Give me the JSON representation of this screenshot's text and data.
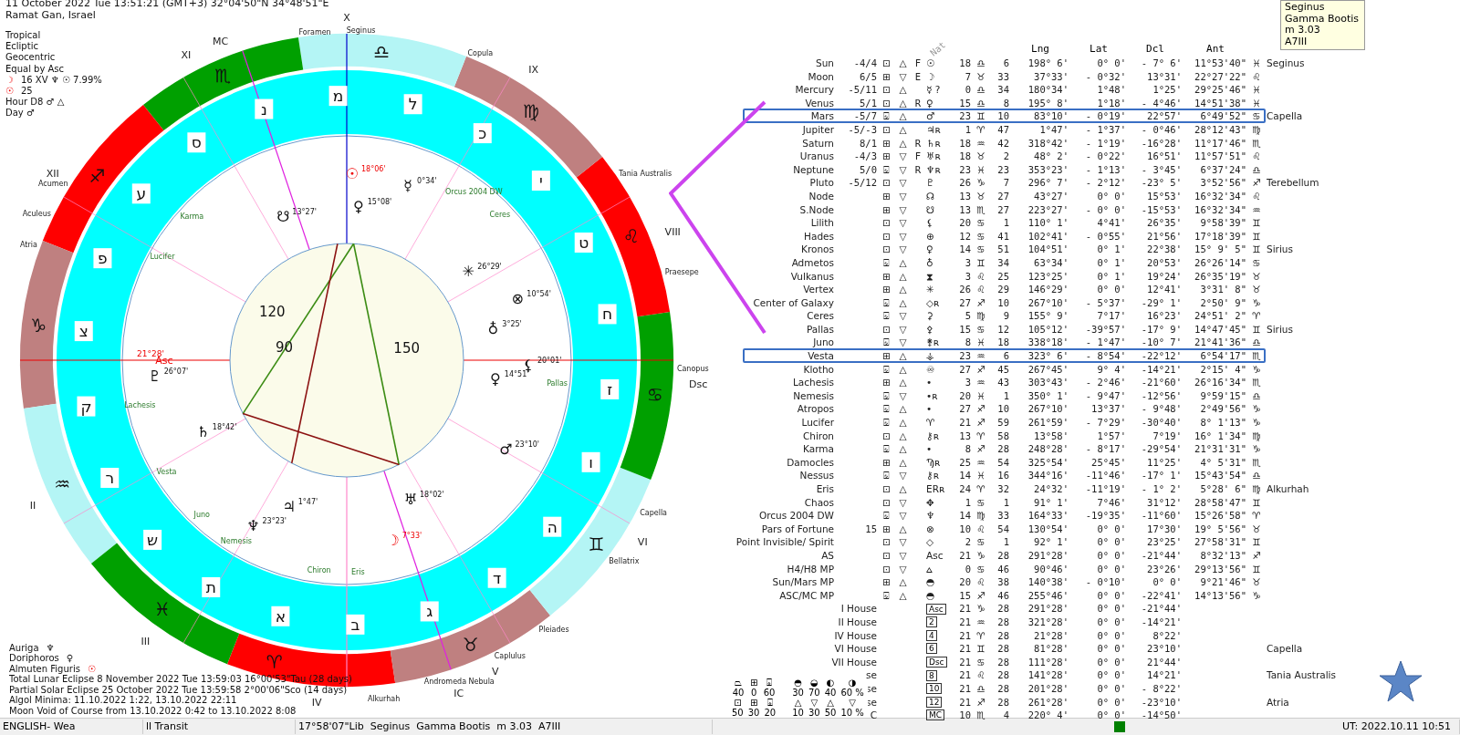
{
  "header": {
    "date_line": "11 October 2022  Tue  13:51:21 (GMT+3) 32°04'50\"N  34°48'51\"E",
    "location": "Ramat Gan, Israel",
    "settings": [
      "Tropical",
      "Ecliptic",
      "Geocentric",
      "Equal by Asc"
    ],
    "lines": [
      {
        "icon": "☽",
        "highlight": true,
        "text": "16 XV ♆ ☉ 7.99%"
      },
      {
        "icon": "☉",
        "highlight": true,
        "text": "25"
      },
      {
        "text": "Hour D8 ♂ △"
      },
      {
        "text": "Day ♂"
      }
    ]
  },
  "footer": {
    "rulers": [
      {
        "label": "Auriga",
        "glyph": "♆",
        "highlight": false
      },
      {
        "label": "Doriphoros",
        "glyph": "♀",
        "highlight": false
      },
      {
        "label": "Almuten Figuris",
        "glyph": "☉",
        "highlight": true
      }
    ],
    "notes": [
      "Total Lunar Eclipse 8 November 2022 Tue 13:59:03 16°00'53\"Tau (28 days)",
      "Partial Solar Eclipse 25 October 2022 Tue 13:59:58  2°00'06\"Sco (14 days)",
      "Algol Minima: 11.10.2022  1:22,  13.10.2022 22:11",
      "Moon Void of Course from 13.10.2022  0:42 to 13.10.2022  8:08"
    ]
  },
  "wheel": {
    "asc_label": "21°28'",
    "zodiac": [
      {
        "glyph": "♈",
        "color": "#ff0000"
      },
      {
        "glyph": "♉",
        "color": "#bf8080"
      },
      {
        "glyph": "♊",
        "color": "#b4f5f5"
      },
      {
        "glyph": "♋",
        "color": "#00a000"
      },
      {
        "glyph": "♌",
        "color": "#ff0000"
      },
      {
        "glyph": "♍",
        "color": "#bf8080"
      },
      {
        "glyph": "♎",
        "color": "#b4f5f5"
      },
      {
        "glyph": "♏",
        "color": "#00a000"
      },
      {
        "glyph": "♐",
        "color": "#ff0000"
      },
      {
        "glyph": "♑",
        "color": "#bf8080"
      },
      {
        "glyph": "♒",
        "color": "#b4f5f5"
      },
      {
        "glyph": "♓",
        "color": "#00a000"
      }
    ],
    "houses": [
      "Asc",
      "II",
      "III",
      "IV",
      "V",
      "VI",
      "Dsc",
      "VIII",
      "IX",
      "X",
      "XI",
      "XII"
    ],
    "angles": [
      {
        "label": "MC"
      },
      {
        "label": "IC"
      }
    ],
    "hebrew_letters": [
      "א",
      "ב",
      "ג",
      "ד",
      "ה",
      "ו",
      "ז",
      "ח",
      "ט",
      "י",
      "כ",
      "ל",
      "מ",
      "נ",
      "ס",
      "ע",
      "פ",
      "צ",
      "ק",
      "ר",
      "ש",
      "ת"
    ],
    "stars": [
      {
        "name": "Foramen"
      },
      {
        "name": "Seginus"
      },
      {
        "name": "Copula"
      },
      {
        "name": "Tania Australis"
      },
      {
        "name": "Praesepe"
      },
      {
        "name": "Canopus"
      },
      {
        "name": "Capella"
      },
      {
        "name": "Bellatrix"
      },
      {
        "name": "Pleiades"
      },
      {
        "name": "Caplulus"
      },
      {
        "name": "Andromeda Nebula"
      },
      {
        "name": "Alkurhah"
      },
      {
        "name": "Atria"
      },
      {
        "name": "Aculeus"
      },
      {
        "name": "Acumen"
      }
    ],
    "points": [
      {
        "glyph": "☉",
        "degree": "18°06'",
        "kind": "luminary"
      },
      {
        "glyph": "♀",
        "degree": "15°08'",
        "kind": "planet"
      },
      {
        "glyph": "☿",
        "degree": "0°34'",
        "kind": "planet"
      },
      {
        "glyph": "✳",
        "degree": "26°29'",
        "kind": "planet"
      },
      {
        "glyph": "⊗",
        "degree": "10°54'",
        "kind": "planet"
      },
      {
        "glyph": "♁",
        "degree": "3°25'",
        "kind": "planet"
      },
      {
        "glyph": "⚸",
        "degree": "20°01'",
        "kind": "planet"
      },
      {
        "glyph": "♀",
        "degree": "14°51'",
        "kind": "planet"
      },
      {
        "glyph": "♂",
        "degree": "23°10'",
        "kind": "planet"
      },
      {
        "glyph": "♅",
        "degree": "18°02'",
        "kind": "planet"
      },
      {
        "glyph": "☽",
        "degree": "7°33'",
        "kind": "luminary"
      },
      {
        "glyph": "♃",
        "degree": "1°47'",
        "kind": "planet"
      },
      {
        "glyph": "♆",
        "degree": "23°23'",
        "kind": "planet"
      },
      {
        "glyph": "♄",
        "degree": "18°42'",
        "kind": "planet"
      },
      {
        "glyph": "♇",
        "degree": "26°07'",
        "kind": "planet"
      },
      {
        "glyph": "☋",
        "degree": "13°27'",
        "kind": "planet"
      }
    ],
    "minor": [
      {
        "name": "Lucifer"
      },
      {
        "name": "Karma"
      },
      {
        "name": "Lachesis"
      },
      {
        "name": "Vesta"
      },
      {
        "name": "Juno"
      },
      {
        "name": "Nemesis"
      },
      {
        "name": "Chiron"
      },
      {
        "name": "Eris"
      },
      {
        "name": "Orcus 2004 DW"
      },
      {
        "name": "Ceres"
      },
      {
        "name": "Pallas"
      }
    ],
    "aspects": [
      {
        "kind": "trine",
        "label": "120"
      },
      {
        "kind": "trine",
        "label": "150"
      },
      {
        "kind": "square",
        "label": "90"
      },
      {
        "kind": "square"
      }
    ]
  },
  "table": {
    "header": {
      "nat": "Nat",
      "lng": "Lng",
      "lat": "Lat",
      "dcl": "Dcl",
      "ant": "Ant"
    },
    "rows": [
      {
        "kind": "point",
        "name": "Sun",
        "score": "-4/4",
        "quad": "⊡",
        "elem": "△",
        "flag": "F",
        "glyph": "☉",
        "deg": "18",
        "sign": "♎",
        "min": "6",
        "lng": "198° 6'",
        "lat": "0° 0'",
        "dcl": "- 7° 6'",
        "ant": "11°53'40\"",
        "ant_sign": "♓",
        "star": "Seginus",
        "selected": false
      },
      {
        "kind": "point",
        "name": "Moon",
        "score": "6/5",
        "quad": "⊞",
        "elem": "▽",
        "flag": "E",
        "glyph": "☽",
        "deg": "7",
        "sign": "♉",
        "min": "33",
        "lng": "37°33'",
        "lat": "- 0°32'",
        "dcl": "13°31'",
        "ant": "22°27'22\"",
        "ant_sign": "♌",
        "selected": false
      },
      {
        "kind": "point",
        "name": "Mercury",
        "score": "-5/11",
        "quad": "⊡",
        "elem": "△",
        "glyph": "☿ ?",
        "deg": "0",
        "sign": "♎",
        "min": "34",
        "lng": "180°34'",
        "lat": "1°48'",
        "dcl": "1°25'",
        "ant": "29°25'46\"",
        "ant_sign": "♓",
        "selected": false
      },
      {
        "kind": "point",
        "name": "Venus",
        "score": "5/1",
        "quad": "⊡",
        "elem": "△",
        "flag": "R",
        "glyph": "♀",
        "deg": "15",
        "sign": "♎",
        "min": "8",
        "lng": "195° 8'",
        "lat": "1°18'",
        "dcl": "- 4°46'",
        "ant": "14°51'38\"",
        "ant_sign": "♓",
        "selected": false
      },
      {
        "kind": "point",
        "name": "Mars",
        "score": "-5/7",
        "quad": "⌺",
        "elem": "△",
        "glyph": "♂",
        "deg": "23",
        "sign": "♊",
        "min": "10",
        "lng": "83°10'",
        "lat": "- 0°19'",
        "dcl": "22°57'",
        "ant": "6°49'52\"",
        "ant_sign": "♋",
        "star": "Capella",
        "selected": true
      },
      {
        "kind": "point",
        "name": "Jupiter",
        "score": "-5/-3",
        "quad": "⊡",
        "elem": "△",
        "glyph": "♃ʀ",
        "deg": "1",
        "sign": "♈",
        "min": "47",
        "lng": "1°47'",
        "lat": "- 1°37'",
        "dcl": "- 0°46'",
        "ant": "28°12'43\"",
        "ant_sign": "♍",
        "selected": false
      },
      {
        "kind": "point",
        "name": "Saturn",
        "score": "8/1",
        "quad": "⊞",
        "elem": "△",
        "flag": "R",
        "glyph": "♄ʀ",
        "deg": "18",
        "sign": "♒",
        "min": "42",
        "lng": "318°42'",
        "lat": "- 1°19'",
        "dcl": "-16°28'",
        "ant": "11°17'46\"",
        "ant_sign": "♏",
        "selected": false
      },
      {
        "kind": "point",
        "name": "Uranus",
        "score": "-4/3",
        "quad": "⊞",
        "elem": "▽",
        "flag": "F",
        "glyph": "♅ʀ",
        "deg": "18",
        "sign": "♉",
        "min": "2",
        "lng": "48° 2'",
        "lat": "- 0°22'",
        "dcl": "16°51'",
        "ant": "11°57'51\"",
        "ant_sign": "♌",
        "selected": false
      },
      {
        "kind": "point",
        "name": "Neptune",
        "score": "5/0",
        "quad": "⌺",
        "elem": "▽",
        "flag": "R",
        "glyph": "♆ʀ",
        "deg": "23",
        "sign": "♓",
        "min": "23",
        "lng": "353°23'",
        "lat": "- 1°13'",
        "dcl": "- 3°45'",
        "ant": "6°37'24\"",
        "ant_sign": "♎",
        "selected": false
      },
      {
        "kind": "point",
        "name": "Pluto",
        "score": "-5/12",
        "quad": "⊡",
        "elem": "▽",
        "glyph": "♇",
        "deg": "26",
        "sign": "♑",
        "min": "7",
        "lng": "296° 7'",
        "lat": "- 2°12'",
        "dcl": "-23° 5'",
        "ant": "3°52'56\"",
        "ant_sign": "♐",
        "star": "Terebellum",
        "selected": false
      },
      {
        "kind": "point",
        "name": "Node",
        "quad": "⊞",
        "elem": "▽",
        "glyph": "☊",
        "deg": "13",
        "sign": "♉",
        "min": "27",
        "lng": "43°27'",
        "lat": "0° 0'",
        "dcl": "15°53'",
        "ant": "16°32'34\"",
        "ant_sign": "♌",
        "selected": false
      },
      {
        "kind": "point",
        "name": "S.Node",
        "quad": "⊞",
        "elem": "▽",
        "glyph": "☋",
        "deg": "13",
        "sign": "♏",
        "min": "27",
        "lng": "223°27'",
        "lat": "- 0° 0'",
        "dcl": "-15°53'",
        "ant": "16°32'34\"",
        "ant_sign": "♒",
        "selected": false
      },
      {
        "kind": "point",
        "name": "Lilith",
        "quad": "⊡",
        "elem": "▽",
        "glyph": "⚸",
        "deg": "20",
        "sign": "♋",
        "min": "1",
        "lng": "110° 1'",
        "lat": "4°41'",
        "dcl": "26°35'",
        "ant": "9°58'39\"",
        "ant_sign": "♊",
        "selected": false
      },
      {
        "kind": "point",
        "name": "Hades",
        "quad": "⊡",
        "elem": "▽",
        "glyph": "⊕",
        "deg": "12",
        "sign": "♋",
        "min": "41",
        "lng": "102°41'",
        "lat": "- 0°55'",
        "dcl": "21°56'",
        "ant": "17°18'39\"",
        "ant_sign": "♊",
        "selected": false
      },
      {
        "kind": "point",
        "name": "Kronos",
        "quad": "⊡",
        "elem": "▽",
        "glyph": "♀",
        "deg": "14",
        "sign": "♋",
        "min": "51",
        "lng": "104°51'",
        "lat": "0° 1'",
        "dcl": "22°38'",
        "ant": "15° 9' 5\"",
        "ant_sign": "♊",
        "star": "Sirius",
        "selected": false
      },
      {
        "kind": "point",
        "name": "Admetos",
        "quad": "⌺",
        "elem": "△",
        "glyph": "♁",
        "deg": "3",
        "sign": "♊",
        "min": "34",
        "lng": "63°34'",
        "lat": "0° 1'",
        "dcl": "20°53'",
        "ant": "26°26'14\"",
        "ant_sign": "♋",
        "selected": false
      },
      {
        "kind": "point",
        "name": "Vulkanus",
        "quad": "⊞",
        "elem": "△",
        "glyph": "⧗",
        "deg": "3",
        "sign": "♌",
        "min": "25",
        "lng": "123°25'",
        "lat": "0° 1'",
        "dcl": "19°24'",
        "ant": "26°35'19\"",
        "ant_sign": "♉",
        "selected": false
      },
      {
        "kind": "point",
        "name": "Vertex",
        "quad": "⊞",
        "elem": "△",
        "glyph": "✳",
        "deg": "26",
        "sign": "♌",
        "min": "29",
        "lng": "146°29'",
        "lat": "0° 0'",
        "dcl": "12°41'",
        "ant": "3°31' 8\"",
        "ant_sign": "♉",
        "selected": false
      },
      {
        "kind": "point",
        "name": "Center of Galaxy",
        "quad": "⌺",
        "elem": "△",
        "glyph": "◇ʀ",
        "deg": "27",
        "sign": "♐",
        "min": "10",
        "lng": "267°10'",
        "lat": "- 5°37'",
        "dcl": "-29° 1'",
        "ant": "2°50' 9\"",
        "ant_sign": "♑",
        "selected": false
      },
      {
        "kind": "point",
        "name": "Ceres",
        "quad": "⌺",
        "elem": "▽",
        "glyph": "⚳",
        "deg": "5",
        "sign": "♍",
        "min": "9",
        "lng": "155° 9'",
        "lat": "7°17'",
        "dcl": "16°23'",
        "ant": "24°51' 2\"",
        "ant_sign": "♈",
        "selected": false
      },
      {
        "kind": "point",
        "name": "Pallas",
        "quad": "⊡",
        "elem": "▽",
        "glyph": "⚴",
        "deg": "15",
        "sign": "♋",
        "min": "12",
        "lng": "105°12'",
        "lat": "-39°57'",
        "dcl": "-17° 9'",
        "ant": "14°47'45\"",
        "ant_sign": "♊",
        "star": "Sirius",
        "selected": false
      },
      {
        "kind": "point",
        "name": "Juno",
        "quad": "⌺",
        "elem": "▽",
        "glyph": "⚵ʀ",
        "deg": "8",
        "sign": "♓",
        "min": "18",
        "lng": "338°18'",
        "lat": "- 1°47'",
        "dcl": "-10° 7'",
        "ant": "21°41'36\"",
        "ant_sign": "♎",
        "selected": false
      },
      {
        "kind": "point",
        "name": "Vesta",
        "quad": "⊞",
        "elem": "△",
        "glyph": "⚶",
        "deg": "23",
        "sign": "♒",
        "min": "6",
        "lng": "323° 6'",
        "lat": "- 8°54'",
        "dcl": "-22°12'",
        "ant": "6°54'17\"",
        "ant_sign": "♏",
        "selected": true
      },
      {
        "kind": "point",
        "name": "Klotho",
        "quad": "⌺",
        "elem": "△",
        "glyph": "♾",
        "deg": "27",
        "sign": "♐",
        "min": "45",
        "lng": "267°45'",
        "lat": "9° 4'",
        "dcl": "-14°21'",
        "ant": "2°15' 4\"",
        "ant_sign": "♑",
        "selected": false
      },
      {
        "kind": "point",
        "name": "Lachesis",
        "quad": "⊞",
        "elem": "△",
        "glyph": "•",
        "deg": "3",
        "sign": "♒",
        "min": "43",
        "lng": "303°43'",
        "lat": "- 2°46'",
        "dcl": "-21°60'",
        "ant": "26°16'34\"",
        "ant_sign": "♏",
        "selected": false
      },
      {
        "kind": "point",
        "name": "Nemesis",
        "quad": "⌺",
        "elem": "▽",
        "glyph": "•ʀ",
        "deg": "20",
        "sign": "♓",
        "min": "1",
        "lng": "350° 1'",
        "lat": "- 9°47'",
        "dcl": "-12°56'",
        "ant": "9°59'15\"",
        "ant_sign": "♎",
        "selected": false
      },
      {
        "kind": "point",
        "name": "Atropos",
        "quad": "⌺",
        "elem": "△",
        "glyph": "•",
        "deg": "27",
        "sign": "♐",
        "min": "10",
        "lng": "267°10'",
        "lat": "13°37'",
        "dcl": "- 9°48'",
        "ant": "2°49'56\"",
        "ant_sign": "♑",
        "selected": false
      },
      {
        "kind": "point",
        "name": "Lucifer",
        "quad": "⌺",
        "elem": "△",
        "glyph": "♈",
        "deg": "21",
        "sign": "♐",
        "min": "59",
        "lng": "261°59'",
        "lat": "- 7°29'",
        "dcl": "-30°40'",
        "ant": "8° 1'13\"",
        "ant_sign": "♑",
        "selected": false
      },
      {
        "kind": "point",
        "name": "Chiron",
        "quad": "⊡",
        "elem": "△",
        "glyph": "⚷ʀ",
        "deg": "13",
        "sign": "♈",
        "min": "58",
        "lng": "13°58'",
        "lat": "1°57'",
        "dcl": "7°19'",
        "ant": "16° 1'34\"",
        "ant_sign": "♍",
        "selected": false
      },
      {
        "kind": "point",
        "name": "Karma",
        "quad": "⌺",
        "elem": "△",
        "glyph": "•",
        "deg": "8",
        "sign": "♐",
        "min": "28",
        "lng": "248°28'",
        "lat": "- 8°17'",
        "dcl": "-29°54'",
        "ant": "21°31'31\"",
        "ant_sign": "♑",
        "selected": false
      },
      {
        "kind": "point",
        "name": "Damocles",
        "quad": "⊞",
        "elem": "△",
        "glyph": "Ϡʀ",
        "deg": "25",
        "sign": "♒",
        "min": "54",
        "lng": "325°54'",
        "lat": "25°45'",
        "dcl": "11°25'",
        "ant": "4° 5'31\"",
        "ant_sign": "♏",
        "selected": false
      },
      {
        "kind": "point",
        "name": "Nessus",
        "quad": "⌺",
        "elem": "▽",
        "glyph": "⚷ʀ",
        "deg": "14",
        "sign": "♓",
        "min": "16",
        "lng": "344°16'",
        "lat": "-11°46'",
        "dcl": "-17° 1'",
        "ant": "15°43'54\"",
        "ant_sign": "♎",
        "selected": false
      },
      {
        "kind": "point",
        "name": "Eris",
        "quad": "⊡",
        "elem": "△",
        "glyph": "ERʀ",
        "deg": "24",
        "sign": "♈",
        "min": "32",
        "lng": "24°32'",
        "lat": "-11°19'",
        "dcl": "- 1° 2'",
        "ant": "5°28' 6\"",
        "ant_sign": "♍",
        "star": "Alkurhah",
        "selected": false
      },
      {
        "kind": "point",
        "name": "Chaos",
        "quad": "⊡",
        "elem": "▽",
        "glyph": "✥",
        "deg": "1",
        "sign": "♋",
        "min": "1",
        "lng": "91° 1'",
        "lat": "7°46'",
        "dcl": "31°12'",
        "ant": "28°58'47\"",
        "ant_sign": "♊",
        "selected": false
      },
      {
        "kind": "point",
        "name": "Orcus 2004 DW",
        "quad": "⌺",
        "elem": "▽",
        "glyph": "♆",
        "deg": "14",
        "sign": "♍",
        "min": "33",
        "lng": "164°33'",
        "lat": "-19°35'",
        "dcl": "-11°60'",
        "ant": "15°26'58\"",
        "ant_sign": "♈",
        "selected": false
      },
      {
        "kind": "point",
        "name": "Pars of Fortune",
        "score": "15",
        "quad": "⊞",
        "elem": "△",
        "glyph": "⊗",
        "deg": "10",
        "sign": "♌",
        "min": "54",
        "lng": "130°54'",
        "lat": "0° 0'",
        "dcl": "17°30'",
        "ant": "19° 5'56\"",
        "ant_sign": "♉",
        "selected": false
      },
      {
        "kind": "point",
        "name": "Point Invisible/ Spirit",
        "quad": "⊡",
        "elem": "▽",
        "glyph": "◇",
        "deg": "2",
        "sign": "♋",
        "min": "1",
        "lng": "92° 1'",
        "lat": "0° 0'",
        "dcl": "23°25'",
        "ant": "27°58'31\"",
        "ant_sign": "♊",
        "selected": false
      },
      {
        "kind": "point",
        "name": "AS",
        "quad": "⊡",
        "elem": "▽",
        "glyph": "Asc",
        "deg": "21",
        "sign": "♑",
        "min": "28",
        "lng": "291°28'",
        "lat": "0° 0'",
        "dcl": "-21°44'",
        "ant": "8°32'13\"",
        "ant_sign": "♐",
        "selected": false
      },
      {
        "kind": "point",
        "name": "H4/H8 MP",
        "quad": "⊡",
        "elem": "▽",
        "glyph": "⩟",
        "deg": "0",
        "sign": "♋",
        "min": "46",
        "lng": "90°46'",
        "lat": "0° 0'",
        "dcl": "23°26'",
        "ant": "29°13'56\"",
        "ant_sign": "♊",
        "selected": false
      },
      {
        "kind": "point",
        "name": "Sun/Mars MP",
        "quad": "⊞",
        "elem": "△",
        "glyph": "◓",
        "deg": "20",
        "sign": "♌",
        "min": "38",
        "lng": "140°38'",
        "lat": "- 0°10'",
        "dcl": "0° 0'",
        "ant": "9°21'46\"",
        "ant_sign": "♉",
        "selected": false
      },
      {
        "kind": "point",
        "name": "ASC/MC MP",
        "quad": "⌺",
        "elem": "△",
        "glyph": "◓",
        "deg": "15",
        "sign": "♐",
        "min": "46",
        "lng": "255°46'",
        "lat": "0° 0'",
        "dcl": "-22°41'",
        "ant": "14°13'56\"",
        "ant_sign": "♑",
        "selected": false
      },
      {
        "kind": "house",
        "name": "I House",
        "glyph": "Asc",
        "deg": "21",
        "sign": "♑",
        "min": "28",
        "lng": "291°28'",
        "lat": "0° 0'",
        "dcl": "-21°44'"
      },
      {
        "kind": "house",
        "name": "II House",
        "glyph": "2",
        "deg": "21",
        "sign": "♒",
        "min": "28",
        "lng": "321°28'",
        "lat": "0° 0'",
        "dcl": "-14°21'"
      },
      {
        "kind": "house",
        "name": "IV House",
        "glyph": "4",
        "deg": "21",
        "sign": "♈",
        "min": "28",
        "lng": "21°28'",
        "lat": "0° 0'",
        "dcl": "8°22'"
      },
      {
        "kind": "house",
        "name": "VI House",
        "glyph": "6",
        "deg": "21",
        "sign": "♊",
        "min": "28",
        "lng": "81°28'",
        "lat": "0° 0'",
        "dcl": "23°10'",
        "star": "Capella"
      },
      {
        "kind": "house",
        "name": "VII House",
        "glyph": "Dsc",
        "deg": "21",
        "sign": "♋",
        "min": "28",
        "lng": "111°28'",
        "lat": "0° 0'",
        "dcl": "21°44'"
      },
      {
        "kind": "house",
        "name": "se",
        "glyph": "8",
        "deg": "21",
        "sign": "♌",
        "min": "28",
        "lng": "141°28'",
        "lat": "0° 0'",
        "dcl": "14°21'",
        "star": "Tania Australis"
      },
      {
        "kind": "house",
        "name": "se",
        "glyph": "10",
        "deg": "21",
        "sign": "♎",
        "min": "28",
        "lng": "201°28'",
        "lat": "0° 0'",
        "dcl": "- 8°22'"
      },
      {
        "kind": "house",
        "name": "se",
        "glyph": "12",
        "deg": "21",
        "sign": "♐",
        "min": "28",
        "lng": "261°28'",
        "lat": "0° 0'",
        "dcl": "-23°10'",
        "star": "Atria"
      },
      {
        "kind": "house",
        "name": "C",
        "glyph": "MC",
        "deg": "10",
        "sign": "♏",
        "min": "4",
        "lng": "220° 4'",
        "lat": "0° 0'",
        "dcl": "-14°50'"
      }
    ]
  },
  "legend": [
    {
      "glyphs": [
        "⏢",
        "⊞",
        "⌺"
      ],
      "values": [
        "40",
        "0",
        "60"
      ]
    },
    {
      "glyphs": [
        "◓",
        "◒",
        "◐",
        "◑"
      ],
      "values": [
        "30",
        "70",
        "40",
        "60"
      ],
      "unit": "%"
    },
    {
      "glyphs": [
        "⊡",
        "⊞",
        "⌺"
      ],
      "values": [
        "50",
        "30",
        "20"
      ]
    },
    {
      "glyphs": [
        "△",
        "▽",
        "△",
        "▽"
      ],
      "values": [
        "10",
        "30",
        "50",
        "10"
      ],
      "unit": "%"
    }
  ],
  "tooltip": [
    "Seginus",
    "Gamma Bootis",
    "m 3.03",
    "A7III"
  ],
  "status_bar": {
    "language": "ENGLISH- Wea",
    "mode": "ll Transit",
    "info": "17°58'07\"Lib  Seginus  Gamma Bootis  m 3.03  A7III",
    "time": "UT: 2022.10.11 10:51"
  }
}
